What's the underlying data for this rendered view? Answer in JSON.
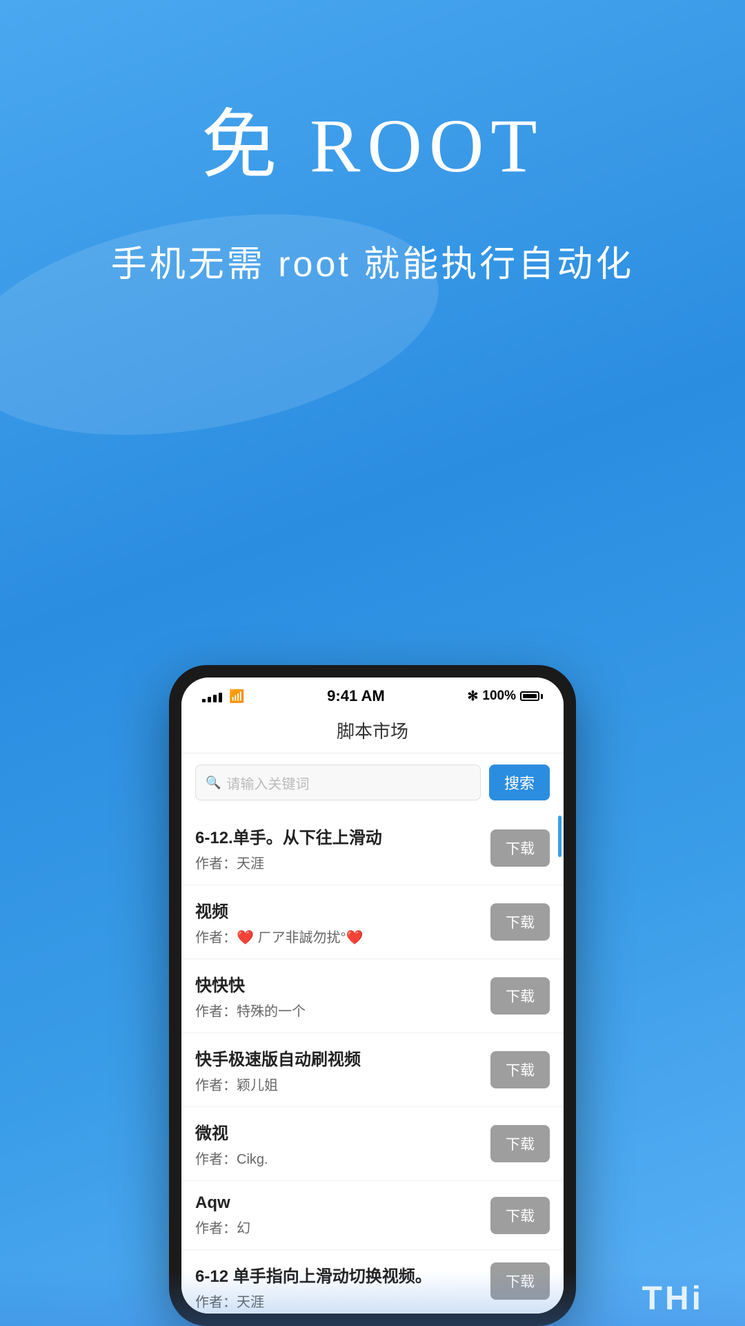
{
  "background": {
    "gradient_start": "#4aa8f0",
    "gradient_end": "#2b8de0"
  },
  "header": {
    "main_title": "免 ROOT",
    "sub_title": "手机无需 root 就能执行自动化"
  },
  "status_bar": {
    "time": "9:41 AM",
    "battery_percent": "100%",
    "bluetooth_icon": "✻"
  },
  "app": {
    "title": "脚本市场"
  },
  "search": {
    "placeholder": "请输入关键词",
    "button_label": "搜索"
  },
  "scripts": [
    {
      "name": "6-12.单手。从下往上滑动",
      "author": "作者：天涯",
      "download_label": "下载"
    },
    {
      "name": "视频",
      "author": "作者：❤️ ㄏア非誠勿扰°❤️",
      "download_label": "下载"
    },
    {
      "name": "快快快",
      "author": "作者：特殊的一个",
      "download_label": "下载"
    },
    {
      "name": "快手极速版自动刷视频",
      "author": "作者：颖儿姐",
      "download_label": "下载"
    },
    {
      "name": "微视",
      "author": "作者：Cikg.",
      "download_label": "下载"
    },
    {
      "name": "Aqw",
      "author": "作者：幻",
      "download_label": "下载"
    },
    {
      "name": "6-12 单手指向上滑动切换视频。",
      "author": "作者：天涯",
      "download_label": "下载"
    }
  ],
  "bottom_watermark": "THi"
}
